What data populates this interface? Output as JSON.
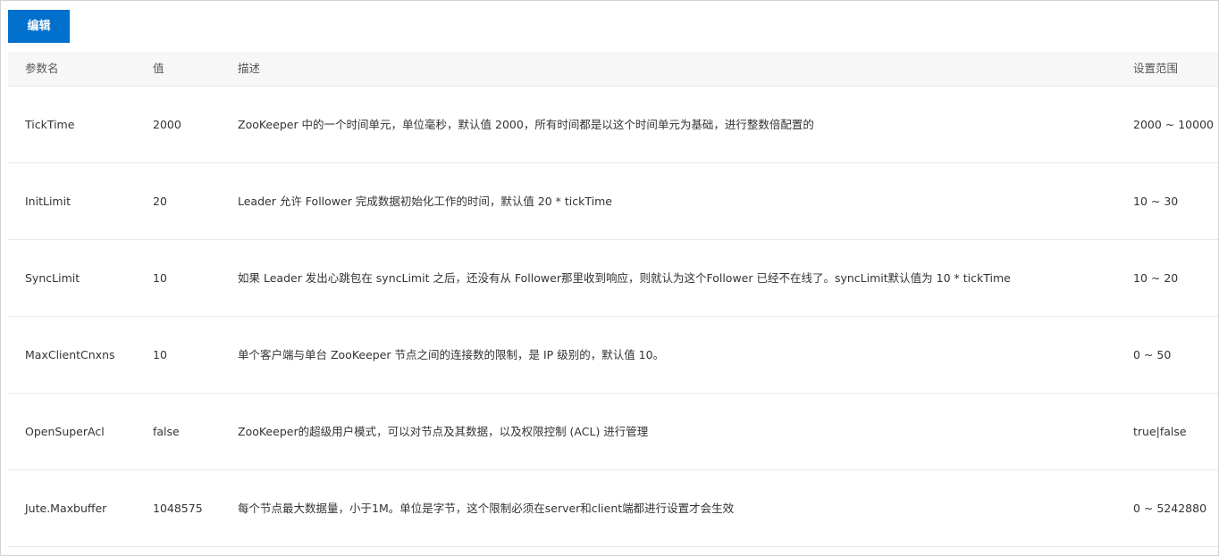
{
  "toolbar": {
    "edit_label": "编辑"
  },
  "table": {
    "headers": {
      "name": "参数名",
      "value": "值",
      "desc": "描述",
      "range": "设置范围"
    },
    "rows": [
      {
        "name": "TickTime",
        "value": "2000",
        "desc": "ZooKeeper 中的一个时间单元，单位毫秒，默认值 2000，所有时间都是以这个时间单元为基础，进行整数倍配置的",
        "range": "2000 ~ 10000"
      },
      {
        "name": "InitLimit",
        "value": "20",
        "desc": "Leader 允许 Follower 完成数据初始化工作的时间，默认值 20 * tickTime",
        "range": "10 ~ 30"
      },
      {
        "name": "SyncLimit",
        "value": "10",
        "desc": "如果 Leader 发出心跳包在 syncLimit 之后，还没有从 Follower那里收到响应，则就认为这个Follower 已经不在线了。syncLimit默认值为 10 * tickTime",
        "range": "10 ~ 20"
      },
      {
        "name": "MaxClientCnxns",
        "value": "10",
        "desc": "单个客户端与单台 ZooKeeper 节点之间的连接数的限制，是 IP 级别的，默认值 10。",
        "range": "0 ~ 50"
      },
      {
        "name": "OpenSuperAcl",
        "value": "false",
        "desc": "ZooKeeper的超级用户模式，可以对节点及其数据，以及权限控制 (ACL) 进行管理",
        "range": "true|false"
      },
      {
        "name": "Jute.Maxbuffer",
        "value": "1048575",
        "desc": "每个节点最大数据量，小于1M。单位是字节，这个限制必须在server和client端都进行设置才会生效",
        "range": "0 ~ 5242880"
      }
    ]
  },
  "colors": {
    "primary": "#0070cc",
    "header_bg": "#f7f7f7",
    "divider": "#e8e8e8"
  }
}
